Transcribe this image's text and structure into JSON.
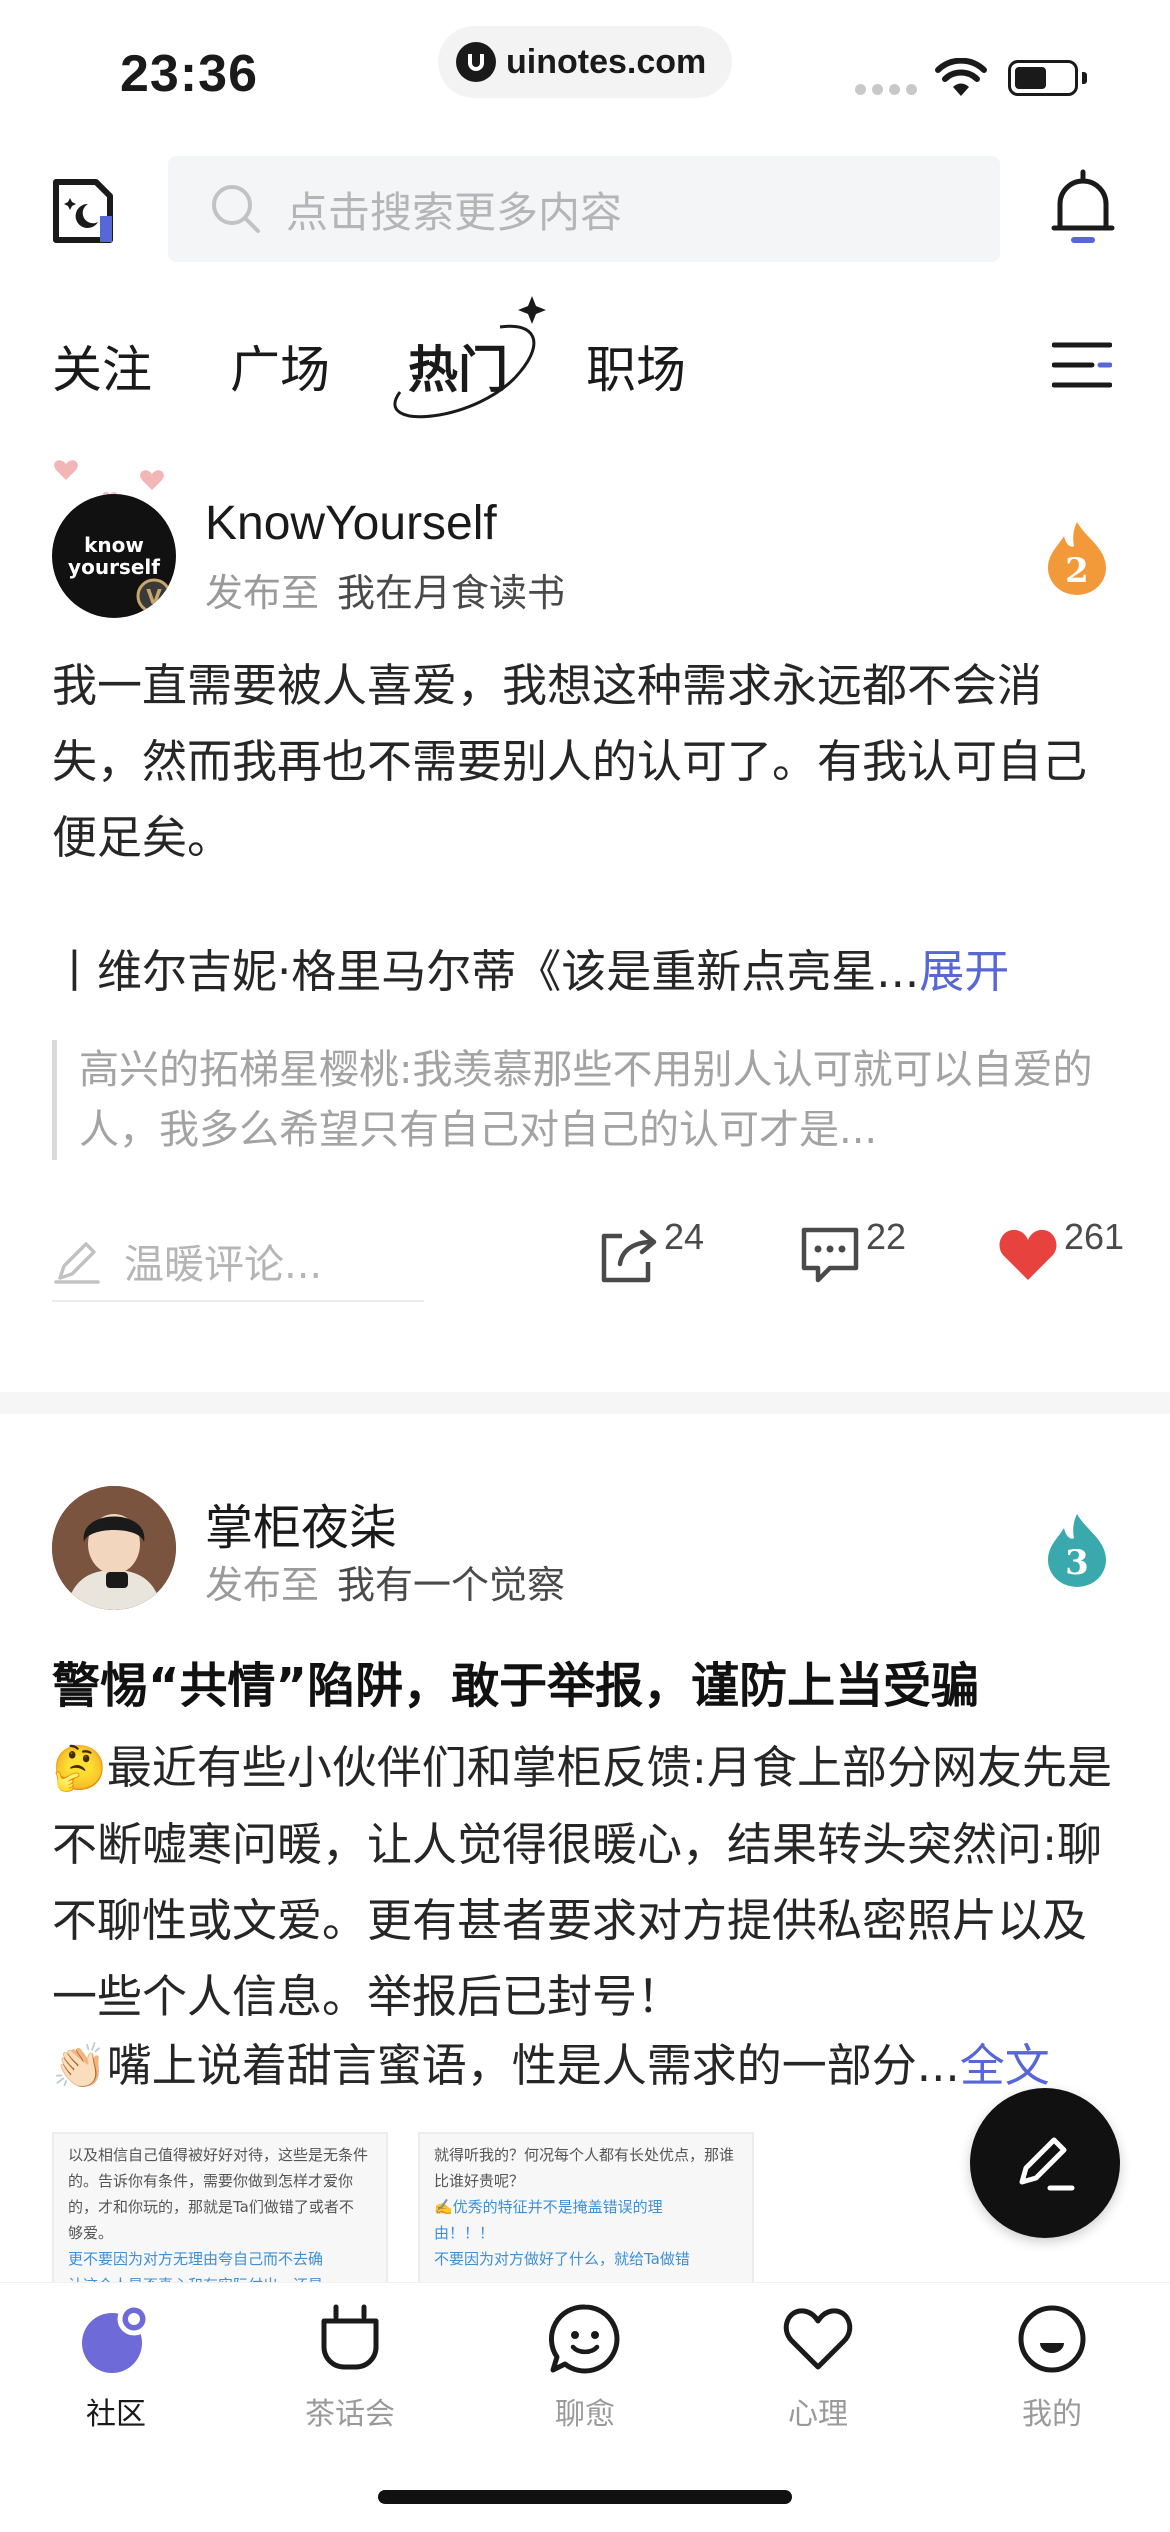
{
  "status_bar": {
    "time": "23:36",
    "url": "uinotes.com"
  },
  "search": {
    "placeholder": "点击搜索更多内容"
  },
  "tabs": [
    {
      "label": "关注"
    },
    {
      "label": "广场"
    },
    {
      "label": "热门"
    },
    {
      "label": "职场"
    }
  ],
  "posts": [
    {
      "author": "KnowYourself",
      "avatar_text": "know yourself",
      "published_label": "发布至",
      "group": "我在月食读书",
      "rank": "2",
      "body": "我一直需要被人喜爱，我想这种需求永远都不会消失，然而我再也不需要别人的认可了。有我认可自己便足矣。",
      "quote": "丨维尔吉妮·格里马尔蒂《该是重新点亮星...",
      "expand_label": "展开",
      "comment_preview": "高兴的拓梯星樱桃:我羡慕那些不用别人认可就可以自爱的人，我多么希望只有自己对自己的认可才是...",
      "comment_placeholder": "温暖评论...",
      "shares": "24",
      "comments": "22",
      "likes": "261"
    },
    {
      "author": "掌柜夜柒",
      "published_label": "发布至",
      "group": "我有一个觉察",
      "rank": "3",
      "title": "警惕“共情”陷阱，敢于举报，谨防上当受骗",
      "body_emoji": "🤔",
      "body": "最近有些小伙伴们和掌柜反馈:月食上部分网友先是不断嘘寒问暖，让人觉得很暖心，结果转头突然问:聊不聊性或文爱。更有甚者要求对方提供私密照片以及一些个人信息。举报后已封号！",
      "line2_emoji": "👏🏻",
      "line2": "嘴上说着甜言蜜语，性是人需求的一部分...",
      "full_text_label": "全文",
      "thumbs": [
        {
          "lines": [
            "以及相信自己值得被好好对待，这些是无条件",
            "的。告诉你有条件，需要你做到怎样才爱你",
            "的，才和你玩的，那就是Ta们做错了或者不",
            "够爱。"
          ],
          "highlight": [
            "更不要因为对方无理由夸自己而不去确",
            "认这个人是否真心和有实际付出，还是"
          ]
        },
        {
          "lines": [
            "就得听我的？何况每个人都有长处优点，那谁",
            "比谁好贵呢？"
          ],
          "highlight": [
            "✍️优秀的特征并不是掩盖错误的理",
            "由！！！",
            "不要因为对方做好了什么，就给Ta做错"
          ]
        }
      ]
    }
  ],
  "bottom_nav": [
    {
      "label": "社区"
    },
    {
      "label": "茶话会"
    },
    {
      "label": "聊愈"
    },
    {
      "label": "心理"
    },
    {
      "label": "我的"
    }
  ],
  "colors": {
    "accent": "#5867d6",
    "like": "#e8423f",
    "rank_orange": "#f29a3a",
    "rank_teal": "#3aa9ad"
  }
}
